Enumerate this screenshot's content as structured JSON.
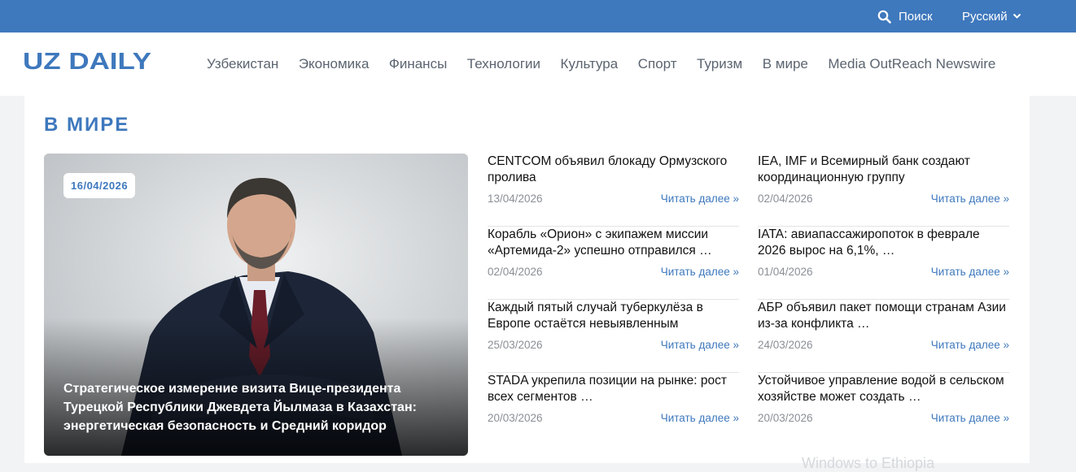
{
  "topbar": {
    "search_label": "Поиск",
    "language": "Русский"
  },
  "header": {
    "logo": "UZ DAILY",
    "nav": [
      "Узбекистан",
      "Экономика",
      "Финансы",
      "Технологии",
      "Культура",
      "Спорт",
      "Туризм",
      "В мире",
      "Media OutReach Newswire"
    ]
  },
  "section": {
    "title": "В МИРЕ"
  },
  "feature": {
    "date": "16/04/2026",
    "title": "Стратегическое измерение визита Вице-президента Турецкой Республики Джевдета Йылмаза в Казахстан: энергетическая безопасность и Средний коридор"
  },
  "news_columns": [
    [
      {
        "title": "CENTCOM объявил блокаду Ормузского пролива",
        "date": "13/04/2026",
        "more": "Читать далее »"
      },
      {
        "title": "Корабль «Орион» с экипажем миссии «Артемида-2» успешно отправился …",
        "date": "02/04/2026",
        "more": "Читать далее »"
      },
      {
        "title": "Каждый пятый случай туберкулёза в Европе остаётся невыявленным",
        "date": "25/03/2026",
        "more": "Читать далее »"
      },
      {
        "title": "STADA укрепила позиции на рынке: рост всех сегментов …",
        "date": "20/03/2026",
        "more": "Читать далее »"
      }
    ],
    [
      {
        "title": "IEA, IMF и Всемирный банк создают координационную группу",
        "date": "02/04/2026",
        "more": "Читать далее »"
      },
      {
        "title": "IATA: авиапассажиропоток в феврале 2026 вырос на 6,1%, …",
        "date": "01/04/2026",
        "more": "Читать далее »"
      },
      {
        "title": "АБР объявил пакет помощи странам Азии из-за конфликта …",
        "date": "24/03/2026",
        "more": "Читать далее »"
      },
      {
        "title": "Устойчивое управление водой в сельском хозяйстве может создать …",
        "date": "20/03/2026",
        "more": "Читать далее »"
      }
    ]
  ],
  "faded_text": "Windows to Ethiopia",
  "colors": {
    "brand_blue": "#3e78bd",
    "nav_text": "#5b6470",
    "date_gray": "#8a8f96"
  }
}
